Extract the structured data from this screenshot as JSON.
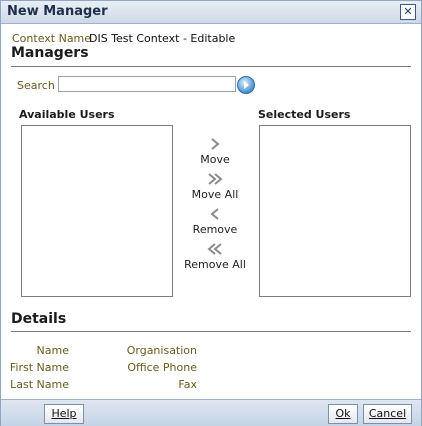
{
  "window": {
    "title": "New Manager",
    "close_icon": "close-icon"
  },
  "context": {
    "label": "Context Name",
    "value": "DIS Test Context - Editable"
  },
  "managers": {
    "heading": "Managers",
    "search": {
      "label": "Search",
      "value": "",
      "go_icon": "go-arrow-icon"
    },
    "available": {
      "heading": "Available Users",
      "items": []
    },
    "selected": {
      "heading": "Selected Users",
      "items": []
    },
    "shuttle": {
      "move": "Move",
      "move_all": "Move All",
      "remove": "Remove",
      "remove_all": "Remove All"
    }
  },
  "details": {
    "heading": "Details",
    "left": [
      "Name",
      "First Name",
      "Last Name"
    ],
    "right": [
      "Organisation",
      "Office Phone",
      "Fax"
    ]
  },
  "footer": {
    "help": "Help",
    "ok": "Ok",
    "cancel": "Cancel"
  },
  "colors": {
    "label": "#6b5a1e",
    "accent": "#4a8fcf",
    "chrome": "#cdd9e8"
  }
}
